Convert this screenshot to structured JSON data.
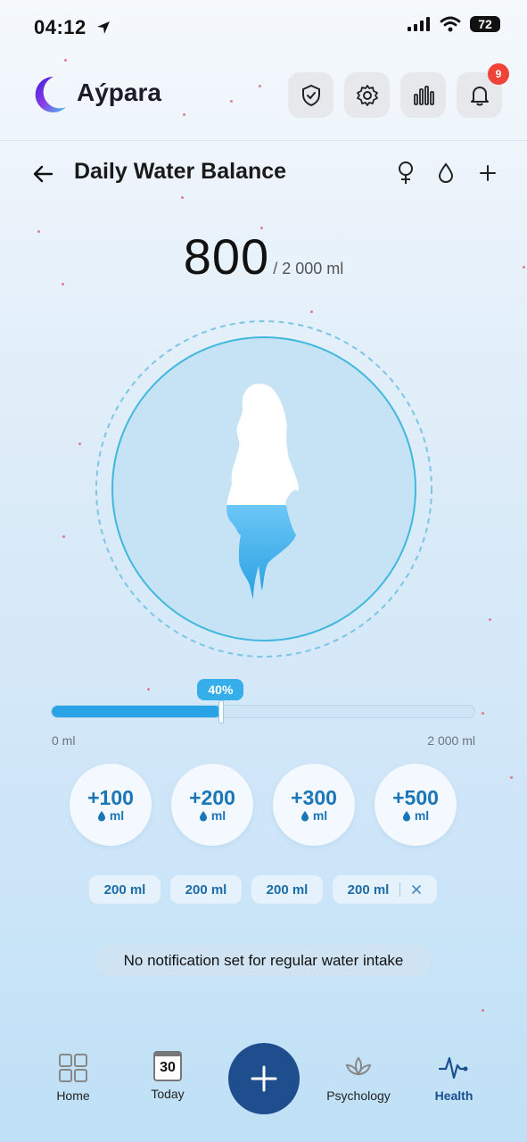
{
  "status_bar": {
    "time": "04:12",
    "battery": "72"
  },
  "header": {
    "app_name": "Aýpara",
    "notification_count": "9"
  },
  "page": {
    "title": "Daily Water Balance"
  },
  "water": {
    "current": "800",
    "goal_text": "/ 2 000 ml",
    "progress_label": "40%",
    "progress_fraction": 0.4,
    "min_label": "0 ml",
    "max_label": "2 000 ml"
  },
  "quick_add": [
    {
      "amount": "+100",
      "unit": "ml"
    },
    {
      "amount": "+200",
      "unit": "ml"
    },
    {
      "amount": "+300",
      "unit": "ml"
    },
    {
      "amount": "+500",
      "unit": "ml"
    }
  ],
  "history_chips": [
    "200 ml",
    "200 ml",
    "200 ml",
    "200 ml"
  ],
  "notice": "No notification set for regular water intake",
  "nav": {
    "home": "Home",
    "today": "Today",
    "today_date": "30",
    "psychology": "Psychology",
    "health": "Health"
  },
  "colors": {
    "accent": "#2aa3e6",
    "nav_active": "#1c4f8f",
    "fab": "#1f4e8f",
    "badge": "#f04438"
  }
}
